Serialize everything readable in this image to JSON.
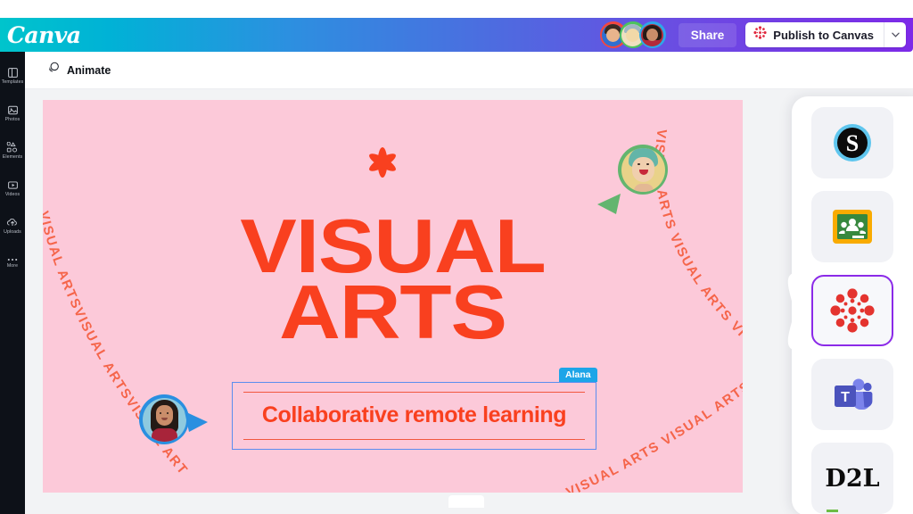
{
  "app": {
    "name": "Canva",
    "logo_text": "Canva"
  },
  "header": {
    "share_label": "Share",
    "publish_label": "Publish to Canvas",
    "publish_icon": "canvas-lms-icon",
    "caret_icon": "chevron-down-icon",
    "collaborators": [
      {
        "name": "collaborator-1",
        "ring_color": "#f2473f",
        "skin": "#e8b48c",
        "hair": "#3a2a22",
        "shirt": "#2f6fd0"
      },
      {
        "name": "collaborator-2",
        "ring_color": "#4cc35e",
        "skin": "#f2d9a8",
        "hair": "#9fb6c2",
        "shirt": "#efe0c0"
      },
      {
        "name": "collaborator-3",
        "ring_color": "#2da7e8",
        "skin": "#c98d6a",
        "hair": "#241a16",
        "shirt": "#b32a3a"
      }
    ]
  },
  "sidebar": {
    "items": [
      {
        "label": "Templates",
        "icon": "templates-icon"
      },
      {
        "label": "Photos",
        "icon": "photos-icon"
      },
      {
        "label": "Elements",
        "icon": "elements-icon"
      },
      {
        "label": "Videos",
        "icon": "videos-icon"
      },
      {
        "label": "Uploads",
        "icon": "uploads-icon"
      },
      {
        "label": "More",
        "icon": "more-dots-icon"
      }
    ]
  },
  "toolbar": {
    "animate_label": "Animate",
    "animate_icon": "animate-circles-icon"
  },
  "design": {
    "background_color": "#fcc9d9",
    "accent_color": "#f9401f",
    "headline_line1": "VISUAL",
    "headline_line2": "ARTS",
    "decor_text": "VISUAL ARTS VISUAL ARTS VISUAL ARTS VISUAL ARTS",
    "asterisk_icon": "asterisk-star-icon",
    "textbox": {
      "text": "Collaborative remote learning",
      "collaborator_tag": "Alana",
      "tag_color": "#1ca5e8",
      "selection_color": "#5b8def"
    },
    "cursors": [
      {
        "name": "cursor-green",
        "color": "#63b56f",
        "ring_color": "#63b56f"
      },
      {
        "name": "cursor-blue",
        "color": "#2a8fe0",
        "ring_color": "#2a8fe0"
      }
    ]
  },
  "apps_panel": {
    "selected_app": "Canvas",
    "selected_border_color": "#8b2ae8",
    "apps": [
      {
        "name": "Schoology",
        "icon": "schoology-icon"
      },
      {
        "name": "Google Classroom",
        "icon": "google-classroom-icon"
      },
      {
        "name": "Canvas",
        "icon": "canvas-lms-icon"
      },
      {
        "name": "Microsoft Teams",
        "icon": "microsoft-teams-icon"
      },
      {
        "name": "D2L",
        "icon": "d2l-icon",
        "text": "D2L"
      }
    ]
  }
}
